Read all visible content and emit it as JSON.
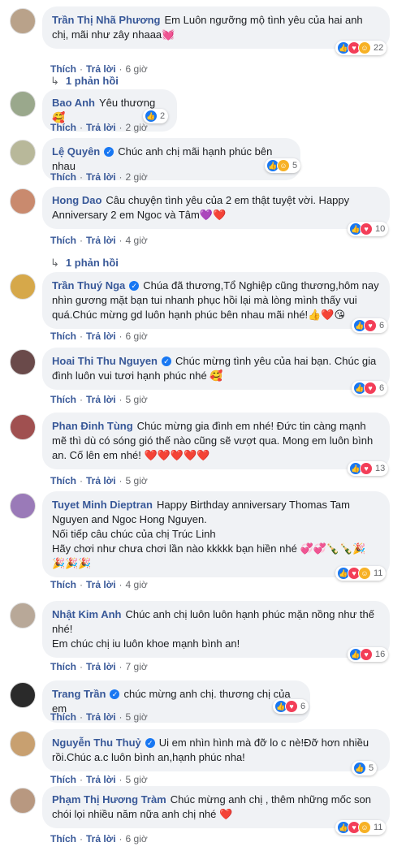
{
  "actions": {
    "like": "Thích",
    "reply": "Trả lời"
  },
  "colors": {
    "like": "#1877f2",
    "love": "#f33e58",
    "care": "#f7b125",
    "name": "#385898"
  },
  "comments": [
    {
      "name": "Trần Thị Nhã Phương",
      "verified": false,
      "text": "Em Luôn ngưỡng mộ tình yêu của hai anh chị, mãi như zây nhaaa💓",
      "time": "6 giờ",
      "reactions": [
        "like",
        "love",
        "care"
      ],
      "count": "22",
      "replies": "1 phản hồi",
      "avatar_color": "#b9a28a"
    },
    {
      "name": "Bao Anh",
      "verified": false,
      "text": "Yêu thương 🥰",
      "time": "2 giờ",
      "reactions": [
        "like"
      ],
      "count": "2",
      "replies": "",
      "avatar_color": "#9aa88c"
    },
    {
      "name": "Lệ Quyên",
      "verified": true,
      "text": "Chúc anh chị mãi hạnh phúc bên nhau",
      "time": "2 giờ",
      "reactions": [
        "like",
        "care"
      ],
      "count": "5",
      "replies": "",
      "avatar_color": "#b8b89a"
    },
    {
      "name": "Hong Dao",
      "verified": false,
      "text": "Câu chuyện tình yêu của 2 em thật tuyệt vời. Happy Anniversary 2 em Ngoc và Tâm💜❤️",
      "time": "4 giờ",
      "reactions": [
        "like",
        "love"
      ],
      "count": "10",
      "replies": "1 phản hồi",
      "avatar_color": "#c98a6e"
    },
    {
      "name": "Trần Thuý Nga",
      "verified": true,
      "text": "Chúa đã thương,Tổ Nghiệp cũng thương,hôm nay nhìn gương mặt bạn tui nhanh phục hồi lại mà lòng mình thấy vui quá.Chúc mừng gd luôn hạnh phúc bên nhau mãi nhé!👍❤️😘",
      "time": "6 giờ",
      "reactions": [
        "like",
        "love"
      ],
      "count": "6",
      "replies": "",
      "avatar_color": "#d6a84a"
    },
    {
      "name": "Hoai Thi Thu Nguyen",
      "verified": true,
      "text": "Chúc mừng tình yêu của hai bạn. Chúc gia đình luôn vui tươi hạnh phúc nhé 🥰",
      "time": "5 giờ",
      "reactions": [
        "like",
        "love"
      ],
      "count": "6",
      "replies": "",
      "avatar_color": "#6a4a4a"
    },
    {
      "name": "Phan Đinh Tùng",
      "verified": false,
      "text": "Chúc mừng gia đình em nhé! Đức tin càng mạnh mẽ thì dù có sóng gió thế nào cũng sẽ vượt qua. Mong em luôn bình an. Cố lên em nhé! ❤️❤️❤️❤️❤️",
      "time": "5 giờ",
      "reactions": [
        "like",
        "love"
      ],
      "count": "13",
      "replies": "",
      "avatar_color": "#a05050"
    },
    {
      "name": "Tuyet Minh Dieptran",
      "verified": false,
      "text": "Happy Birthday anniversary Thomas Tam Nguyen and Ngoc Hong Nguyen.\nNối tiếp câu chúc của chị Trúc Linh\nHãy chơi như chưa chơi lần nào kkkkk bạn hiền nhé 💞💞🍾🍾🎉\n🎉🎉🎉",
      "time": "4 giờ",
      "reactions": [
        "like",
        "love",
        "care"
      ],
      "count": "11",
      "replies": "",
      "avatar_color": "#9a7ab8"
    },
    {
      "name": "Nhật Kim Anh",
      "verified": false,
      "text": "Chúc anh chị luôn luôn hạnh phúc mặn nồng như thế nhé!\nEm chúc chị iu luôn khoe mạnh bình an!",
      "time": "7 giờ",
      "reactions": [
        "like",
        "love"
      ],
      "count": "16",
      "replies": "",
      "avatar_color": "#b8a898"
    },
    {
      "name": "Trang Trần",
      "verified": true,
      "text": "chúc mừng anh chị. thương chị của em",
      "time": "5 giờ",
      "reactions": [
        "like",
        "love"
      ],
      "count": "6",
      "replies": "",
      "avatar_color": "#2a2a2a"
    },
    {
      "name": "Nguyễn Thu Thuỷ",
      "verified": true,
      "text": "Ui em nhìn hình mà đỡ lo c nè!Đỡ hơn nhiều rồi.Chúc a.c luôn bình an,hạnh phúc nha!",
      "time": "5 giờ",
      "reactions": [
        "like"
      ],
      "count": "5",
      "replies": "",
      "avatar_color": "#c8a070"
    },
    {
      "name": "Phạm Thị Hương Tràm",
      "verified": false,
      "text": "Chúc mừng anh chị , thêm những mốc son chói lọi nhiều năm nữa anh chị nhé ❤️",
      "time": "6 giờ",
      "reactions": [
        "like",
        "love",
        "care"
      ],
      "count": "11",
      "replies": "",
      "avatar_color": "#b89880"
    }
  ]
}
